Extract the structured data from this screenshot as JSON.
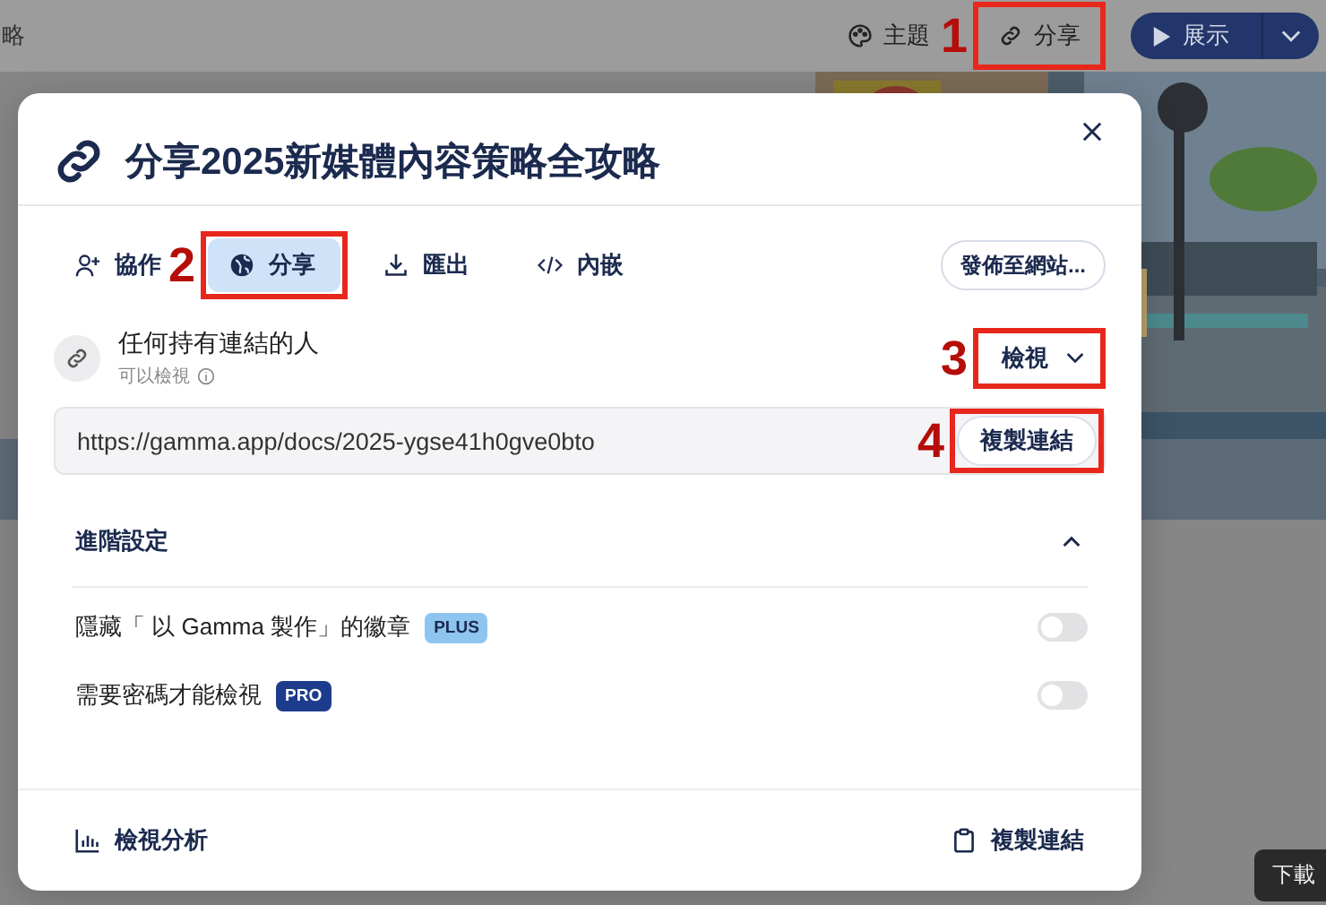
{
  "background_page": {
    "breadcrumb": "略",
    "toolbar": [
      {
        "kind": "theme",
        "label": "主題"
      },
      {
        "kind": "share",
        "label": "分享",
        "annotation": "1"
      }
    ],
    "present_button": "展示",
    "tooltip": "下載"
  },
  "dialog": {
    "title": "分享2025新媒體內容策略全攻略",
    "tabs": [
      {
        "kind": "collaborate",
        "label": "協作",
        "selected": false
      },
      {
        "kind": "share",
        "label": "分享",
        "selected": true,
        "annotation": "2"
      },
      {
        "kind": "export",
        "label": "匯出",
        "selected": false
      },
      {
        "kind": "embed",
        "label": "內嵌",
        "selected": false
      }
    ],
    "publish_button": "發佈至網站...",
    "access": {
      "title": "任何持有連結的人",
      "subtitle": "可以檢視",
      "permission": "檢視",
      "annotation": "3"
    },
    "link": {
      "value": "https://gamma.app/docs/2025-ygse41h0gve0bto",
      "copy_button": "複製連結",
      "annotation": "4"
    },
    "advanced": {
      "title": "進階設定",
      "expanded": true,
      "settings": [
        {
          "label": "隱藏「 以 Gamma 製作」的徽章",
          "badge": {
            "text": "PLUS",
            "color": "#8ec5f0"
          },
          "on": false
        },
        {
          "label": "需要密碼才能檢視",
          "badge": {
            "text": "PRO",
            "color": "#1e3c8c"
          },
          "on": false
        }
      ]
    },
    "footer": {
      "analytics": "檢視分析",
      "copy_link": "複製連結"
    }
  }
}
